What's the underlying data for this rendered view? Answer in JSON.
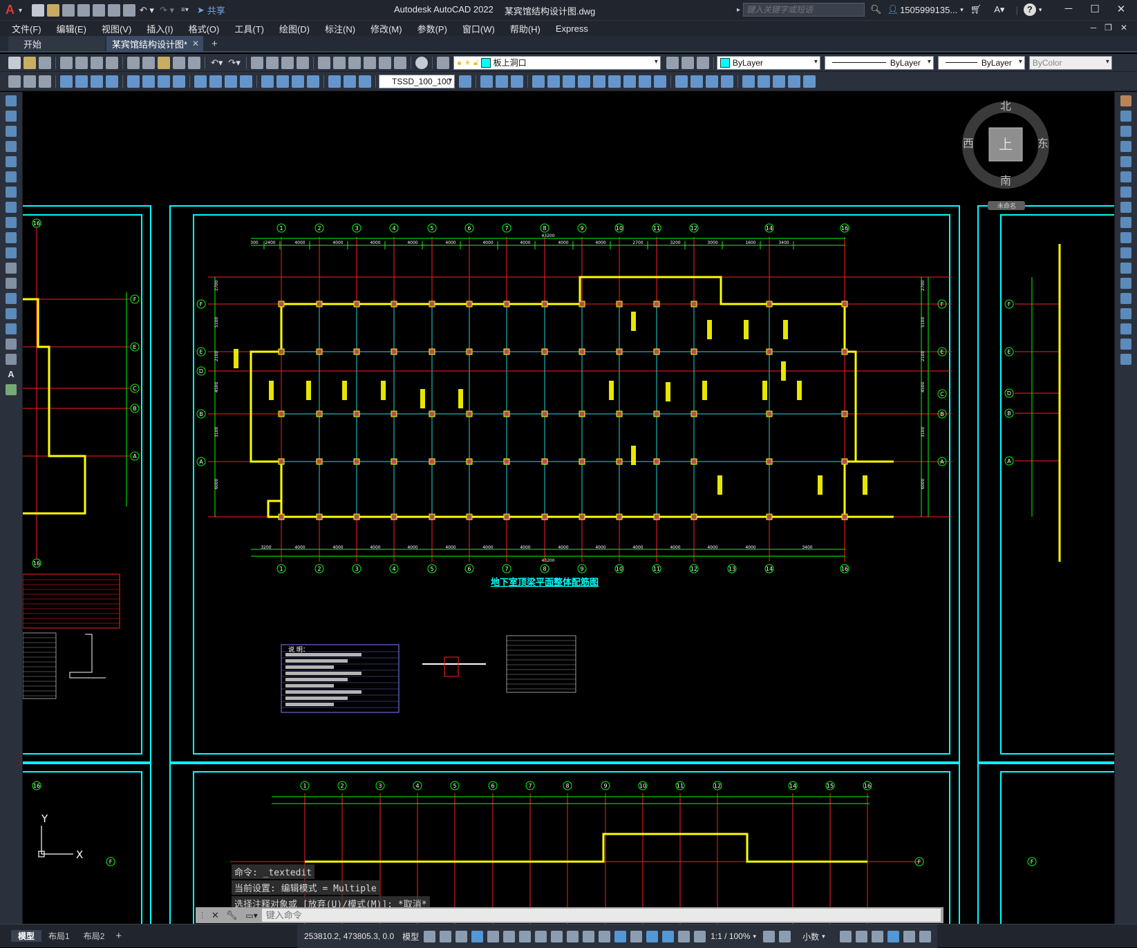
{
  "titlebar": {
    "app_logo": "A",
    "app_name": "Autodesk AutoCAD 2022",
    "file_name": "某宾馆结构设计图.dwg",
    "share_label": "共享",
    "search_placeholder": "键入关键字或短语",
    "user": "1505999135...",
    "help": "?"
  },
  "menu": [
    "文件(F)",
    "编辑(E)",
    "视图(V)",
    "插入(I)",
    "格式(O)",
    "工具(T)",
    "绘图(D)",
    "标注(N)",
    "修改(M)",
    "参数(P)",
    "窗口(W)",
    "帮助(H)",
    "Express"
  ],
  "tabs": {
    "start": "开始",
    "doc": "某宾馆结构设计图*",
    "add": "+"
  },
  "toolbar": {
    "layer": "板上洞口",
    "color": "ByLayer",
    "linetype": "ByLayer",
    "lineweight": "ByLayer",
    "plotstyle": "ByColor",
    "textstyle": "TSSD_100_100"
  },
  "compass": {
    "north": "北",
    "south": "南",
    "east": "东",
    "west": "西",
    "top": "上",
    "ucs": "未命名"
  },
  "drawing": {
    "main_title": "地下室顶梁平面整体配筋图",
    "grid_top": [
      "1",
      "2",
      "3",
      "4",
      "5",
      "6",
      "7",
      "8",
      "9",
      "10",
      "11",
      "12",
      "14",
      "16"
    ],
    "grid_bottom": [
      "1",
      "2",
      "3",
      "4",
      "5",
      "6",
      "7",
      "8",
      "9",
      "10",
      "11",
      "12",
      "13",
      "14",
      "16"
    ],
    "grid_left": [
      "F",
      "E",
      "D",
      "B",
      "A"
    ],
    "grid_right": [
      "F",
      "E",
      "C",
      "B",
      "A"
    ],
    "lower_grid_top": [
      "1",
      "2",
      "3",
      "4",
      "5",
      "6",
      "7",
      "8",
      "9",
      "10",
      "11",
      "12",
      "14",
      "15",
      "16"
    ],
    "left_grid": [
      "F",
      "E",
      "C",
      "B",
      "A"
    ],
    "col_dims": [
      "300",
      "2400",
      "4000",
      "4000",
      "4000",
      "4000",
      "4000",
      "4000",
      "4000",
      "4000",
      "4000",
      "2700",
      "3200",
      "3000",
      "1600",
      "3400"
    ],
    "bottom_dims": [
      "3200",
      "4000",
      "4000",
      "4000",
      "4000",
      "4000",
      "4000",
      "4000",
      "4000",
      "4000",
      "4000",
      "4000",
      "4000",
      "4000",
      "3400"
    ],
    "overall": "43200",
    "row_dims": [
      "2700",
      "5100",
      "2100",
      "4500",
      "3100",
      "6000"
    ],
    "notes_title": "说 明："
  },
  "command": {
    "lines": [
      "命令: _textedit",
      "当前设置: 编辑模式 = Multiple",
      "选择注释对象或 [放弃(U)/模式(M)]: *取消*"
    ],
    "placeholder": "键入命令"
  },
  "status": {
    "layouts": [
      "模型",
      "布局1",
      "布局2"
    ],
    "add_layout": "+",
    "coords": "253810.2, 473805.3, 0.0",
    "model": "模型",
    "scale": "1:1 / 100%",
    "units": "小数"
  },
  "ucs": {
    "y": "Y",
    "x": "X"
  },
  "colors": {
    "frame": "#00ffff",
    "axis": "#ff2020",
    "dim": "#00ff00",
    "beam": "#ffff00",
    "title": "#00ffff",
    "background": "#000000",
    "chrome": "#21252e"
  }
}
